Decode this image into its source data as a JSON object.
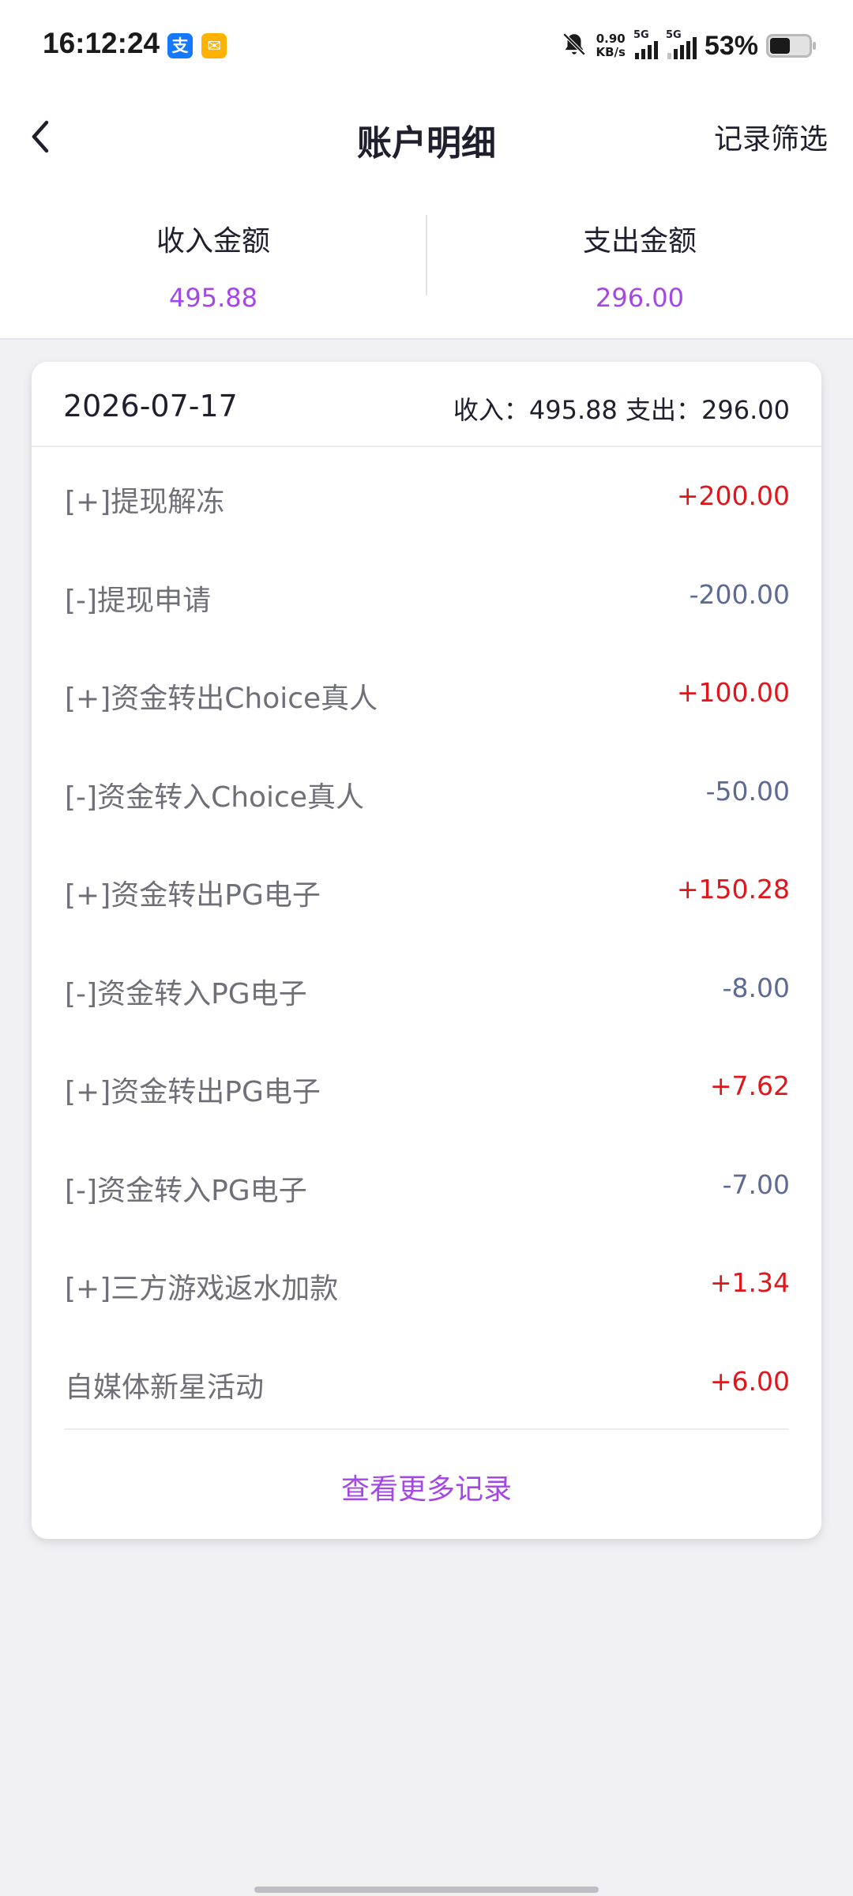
{
  "status_bar": {
    "time": "16:12:24",
    "app_icons": [
      {
        "name": "alipay-icon",
        "glyph": "支"
      },
      {
        "name": "mail-icon",
        "glyph": "✉"
      }
    ],
    "net_speed_value": "0.90",
    "net_speed_unit": "KB/s",
    "signal_1_label": "5G",
    "signal_2_label": "5G",
    "battery_percent": "53%",
    "battery_level": 0.53
  },
  "header": {
    "title": "账户明细",
    "filter_label": "记录筛选",
    "back_icon": "chevron-left-icon"
  },
  "summary": {
    "income_label": "收入金额",
    "income_value": "495.88",
    "expense_label": "支出金额",
    "expense_value": "296.00"
  },
  "card": {
    "date": "2026-07-17",
    "totals": "收入：495.88 支出：296.00",
    "records": [
      {
        "label": "[+]提现解冻",
        "amount": "+200.00",
        "type": "income"
      },
      {
        "label": "[-]提现申请",
        "amount": "-200.00",
        "type": "expense"
      },
      {
        "label": "[+]资金转出Choice真人",
        "amount": "+100.00",
        "type": "income"
      },
      {
        "label": "[-]资金转入Choice真人",
        "amount": "-50.00",
        "type": "expense"
      },
      {
        "label": "[+]资金转出PG电子",
        "amount": "+150.28",
        "type": "income"
      },
      {
        "label": "[-]资金转入PG电子",
        "amount": "-8.00",
        "type": "expense"
      },
      {
        "label": "[+]资金转出PG电子",
        "amount": "+7.62",
        "type": "income"
      },
      {
        "label": "[-]资金转入PG电子",
        "amount": "-7.00",
        "type": "expense"
      },
      {
        "label": "[+]三方游戏返水加款",
        "amount": "+1.34",
        "type": "income"
      },
      {
        "label": "自媒体新星活动",
        "amount": "+6.00",
        "type": "income"
      }
    ],
    "more_label": "查看更多记录"
  },
  "colors": {
    "accent": "#a447e6",
    "income": "#e0161b",
    "expense": "#5d6a93"
  }
}
